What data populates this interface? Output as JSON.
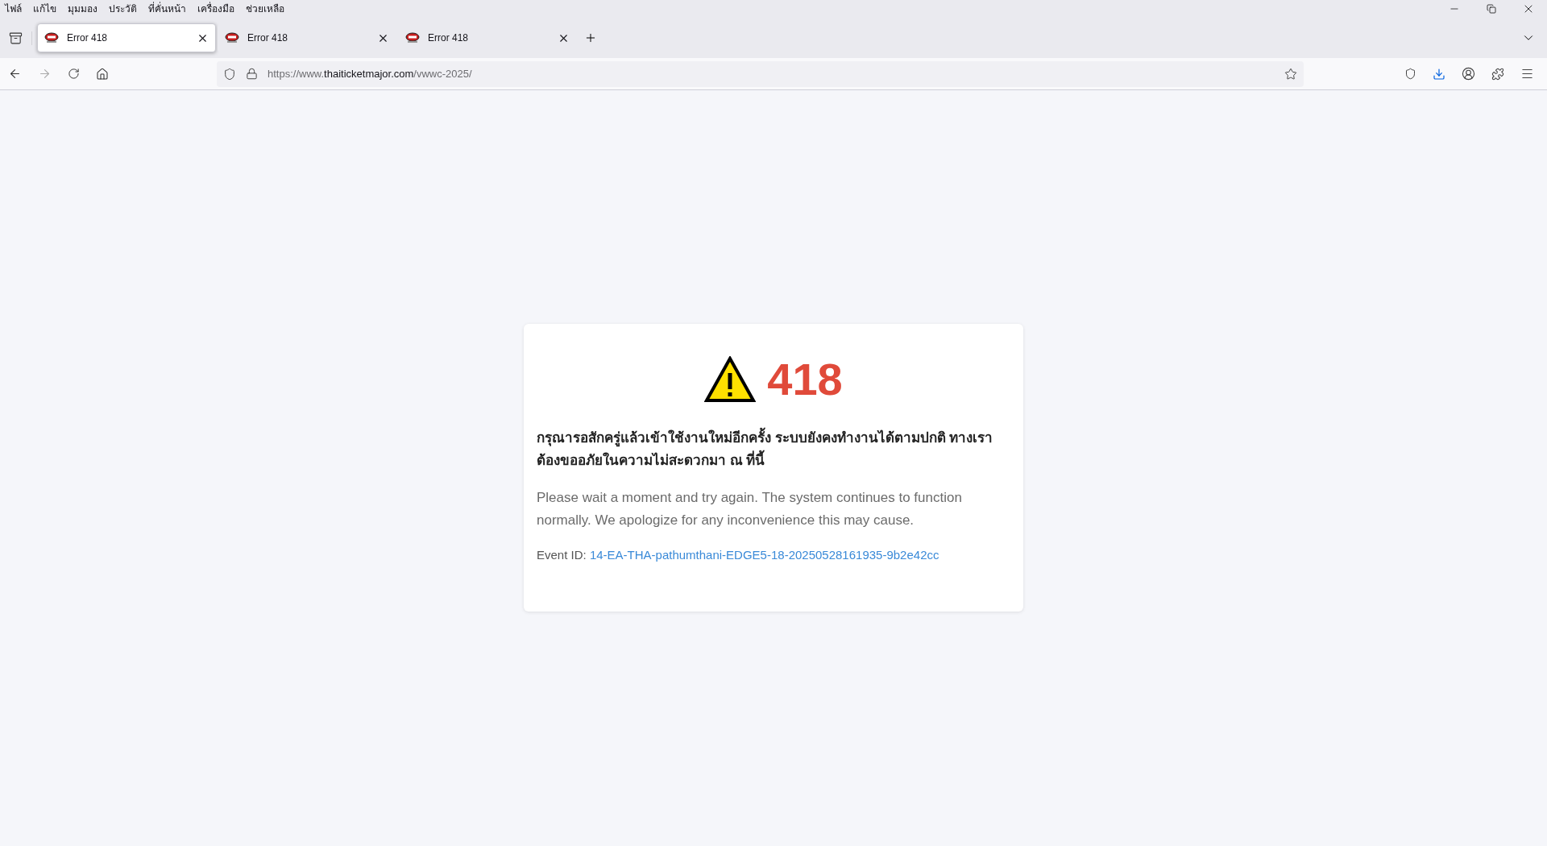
{
  "menu_bar": [
    "ไฟล์",
    "แก้ไข",
    "มุมมอง",
    "ประวัติ",
    "ที่คั่นหน้า",
    "เครื่องมือ",
    "ช่วยเหลือ"
  ],
  "tabs": [
    {
      "title": "Error 418",
      "selected": true
    },
    {
      "title": "Error 418",
      "selected": false
    },
    {
      "title": "Error 418",
      "selected": false
    }
  ],
  "address_bar": {
    "prefix": "https://www.",
    "domain": "thaiticketmajor.com",
    "path": "/vwwc-2025/"
  },
  "error_card": {
    "code": "418",
    "thai_message": "กรุณารอสักครู่แล้วเข้าใช้งานใหม่อีกครั้ง ระบบยังคงทำงานได้ตามปกติ ทางเราต้องขออภัยในความไม่สะดวกมา ณ ที่นี้",
    "english_message": "Please wait a moment and try again. The system continues to function normally. We apologize for any inconvenience this may cause.",
    "event_id_label": "Event ID:",
    "event_id": "14-EA-THA-pathumthani-EDGE5-18-20250528161935-9b2e42cc"
  }
}
